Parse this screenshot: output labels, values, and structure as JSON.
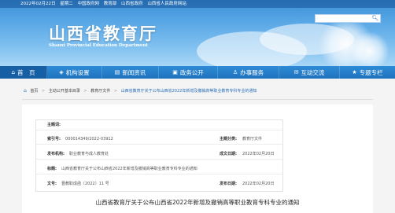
{
  "topbar": {
    "date": "2022年02月22日",
    "weekday": "星期二",
    "links": [
      "中国政府网",
      "教育部",
      "山西省政府",
      "山西省人民政府网站"
    ]
  },
  "header": {
    "title": "山西省教育厅",
    "subtitle": "Shanxi Provincial Education Department",
    "search_placeholder": ""
  },
  "nav": {
    "items": [
      {
        "label": "首　页",
        "icon": "home-icon"
      },
      {
        "label": "机构设置",
        "icon": "org-icon"
      },
      {
        "label": "新闻资讯",
        "icon": "news-icon"
      },
      {
        "label": "政务公开",
        "icon": "doc-icon"
      },
      {
        "label": "办事服务",
        "icon": "service-icon"
      },
      {
        "label": "互动交流",
        "icon": "chat-icon"
      },
      {
        "label": "专题专栏",
        "icon": "topic-icon"
      }
    ]
  },
  "breadcrumb": [
    "首页",
    "主动公开基本目录",
    "教育厅文件",
    "山西省教育厅关于公布山西省2022年新增及撤销高等职业教育专科专业的通知"
  ],
  "meta": {
    "index_label": "主题词:",
    "index_value": "",
    "sn_label": "索引号:",
    "sn_value": "000014349/2022-03912",
    "category_label": "主题分类:",
    "category_value": "教育厅文件",
    "org_label": "发布机构:",
    "org_value": "职业教育与成人教育处",
    "date_label": "成文日期:",
    "date_value": "2022年02月20日",
    "title_label": "标题:",
    "title_value": "山西省教育厅关于公布山西省2022年新增及撤销高等职业教育专科专业的通知",
    "doc_label": "文号:",
    "doc_value": "晋教职成函〔2022〕11 号",
    "pub_label": "发布日期:",
    "pub_value": "2022年02月20日"
  },
  "document": {
    "title": "山西省教育厅关于公布山西省2022年新增及撤销高等职业教育专科专业的通知"
  },
  "colors": {
    "nav_bg": "#1e72bd",
    "banner_top": "#3a8fd6",
    "banner_bottom": "#a9d6f6",
    "page_bg": "#f4f4f4"
  }
}
